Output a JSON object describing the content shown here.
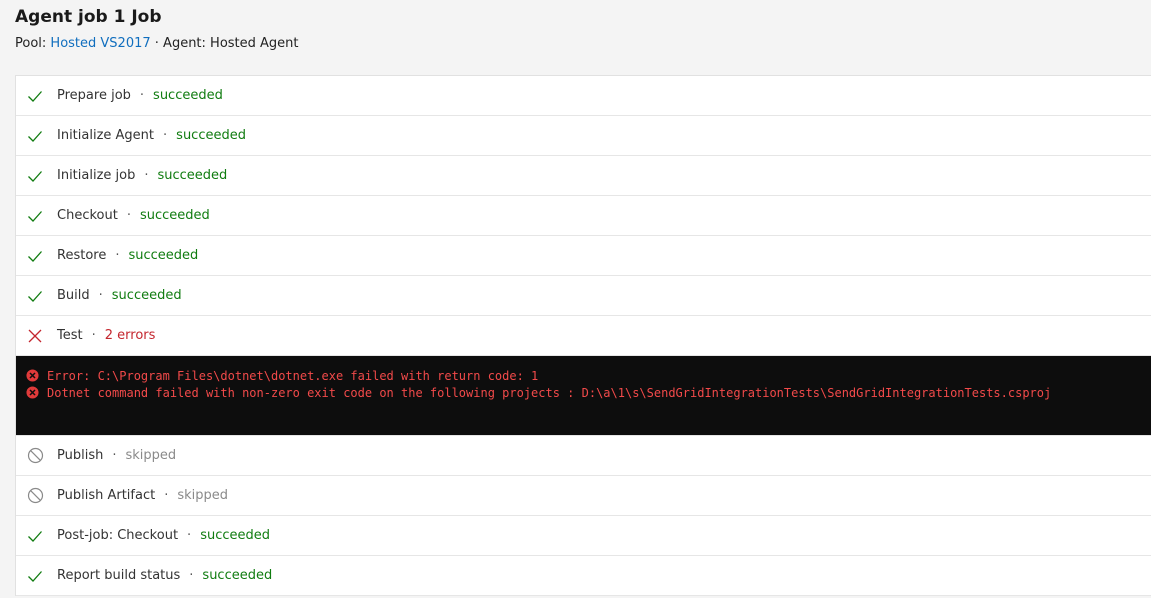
{
  "header": {
    "title": "Agent job 1 Job",
    "pool_label": "Pool: ",
    "pool_link": "Hosted VS2017",
    "agent_sep": " · ",
    "agent_text": "Agent: Hosted Agent"
  },
  "separator": "·",
  "steps": [
    {
      "name": "Prepare job",
      "status": "succeeded",
      "icon": "check-icon"
    },
    {
      "name": "Initialize Agent",
      "status": "succeeded",
      "icon": "check-icon"
    },
    {
      "name": "Initialize job",
      "status": "succeeded",
      "icon": "check-icon"
    },
    {
      "name": "Checkout",
      "status": "succeeded",
      "icon": "check-icon"
    },
    {
      "name": "Restore",
      "status": "succeeded",
      "icon": "check-icon"
    },
    {
      "name": "Build",
      "status": "succeeded",
      "icon": "check-icon"
    },
    {
      "name": "Test",
      "status": "2 errors",
      "icon": "x-icon"
    },
    {
      "name": "Publish",
      "status": "skipped",
      "icon": "skipped-icon"
    },
    {
      "name": "Publish Artifact",
      "status": "skipped",
      "icon": "skipped-icon"
    },
    {
      "name": "Post-job: Checkout",
      "status": "succeeded",
      "icon": "check-icon"
    },
    {
      "name": "Report build status",
      "status": "succeeded",
      "icon": "check-icon"
    }
  ],
  "errors": [
    "Error: C:\\Program Files\\dotnet\\dotnet.exe failed with return code: 1",
    "Dotnet command failed with non-zero exit code on the following projects : D:\\a\\1\\s\\SendGridIntegrationTests\\SendGridIntegrationTests.csproj"
  ],
  "colors": {
    "success": "#107c10",
    "error": "#c4262e",
    "skipped": "#8a8a8a",
    "link": "#106ebe",
    "log_bg": "#0d0d0d"
  }
}
